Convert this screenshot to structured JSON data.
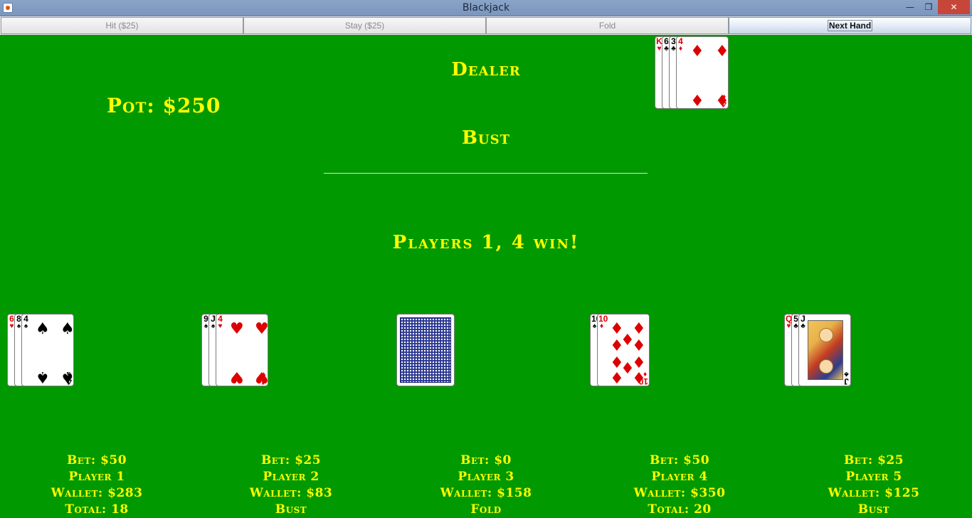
{
  "window": {
    "title": "Blackjack"
  },
  "toolbar": {
    "hit_label": "Hit ($25)",
    "stay_label": "Stay ($25)",
    "fold_label": "Fold",
    "next_label": "Next Hand"
  },
  "table": {
    "dealer_label": "Dealer",
    "dealer_status": "Bust",
    "pot_text": "Pot: $250",
    "result_text": "Players 1, 4 win!"
  },
  "dealer": {
    "cards": [
      {
        "rank": "K",
        "suit": "♥",
        "color": "red"
      },
      {
        "rank": "6",
        "suit": "♣",
        "color": "black"
      },
      {
        "rank": "3",
        "suit": "♣",
        "color": "black"
      },
      {
        "rank": "4",
        "suit": "♦",
        "color": "red"
      }
    ]
  },
  "players": [
    {
      "bet": "Bet: $50",
      "name": "Player 1",
      "wallet": "Wallet: $283",
      "status": "Total: 18",
      "cards": [
        {
          "rank": "6",
          "suit": "♥",
          "color": "red"
        },
        {
          "rank": "8",
          "suit": "♠",
          "color": "black"
        },
        {
          "rank": "4",
          "suit": "♠",
          "color": "black"
        }
      ]
    },
    {
      "bet": "Bet: $25",
      "name": "Player 2",
      "wallet": "Wallet: $83",
      "status": "Bust",
      "cards": [
        {
          "rank": "9",
          "suit": "♠",
          "color": "black"
        },
        {
          "rank": "J",
          "suit": "♠",
          "color": "black"
        },
        {
          "rank": "4",
          "suit": "♥",
          "color": "red"
        }
      ]
    },
    {
      "bet": "Bet: $0",
      "name": "Player 3",
      "wallet": "Wallet: $158",
      "status": "Fold",
      "cards": []
    },
    {
      "bet": "Bet: $50",
      "name": "Player 4",
      "wallet": "Wallet: $350",
      "status": "Total: 20",
      "cards": [
        {
          "rank": "10",
          "suit": "♠",
          "color": "black"
        },
        {
          "rank": "10",
          "suit": "♦",
          "color": "red"
        }
      ]
    },
    {
      "bet": "Bet: $25",
      "name": "Player 5",
      "wallet": "Wallet: $125",
      "status": "Bust",
      "cards": [
        {
          "rank": "Q",
          "suit": "♥",
          "color": "red"
        },
        {
          "rank": "5",
          "suit": "♣",
          "color": "black"
        },
        {
          "rank": "J",
          "suit": "♣",
          "color": "black"
        }
      ]
    }
  ],
  "colors": {
    "felt": "#009900",
    "text": "#ffff00",
    "card_back": "#2a3690"
  }
}
